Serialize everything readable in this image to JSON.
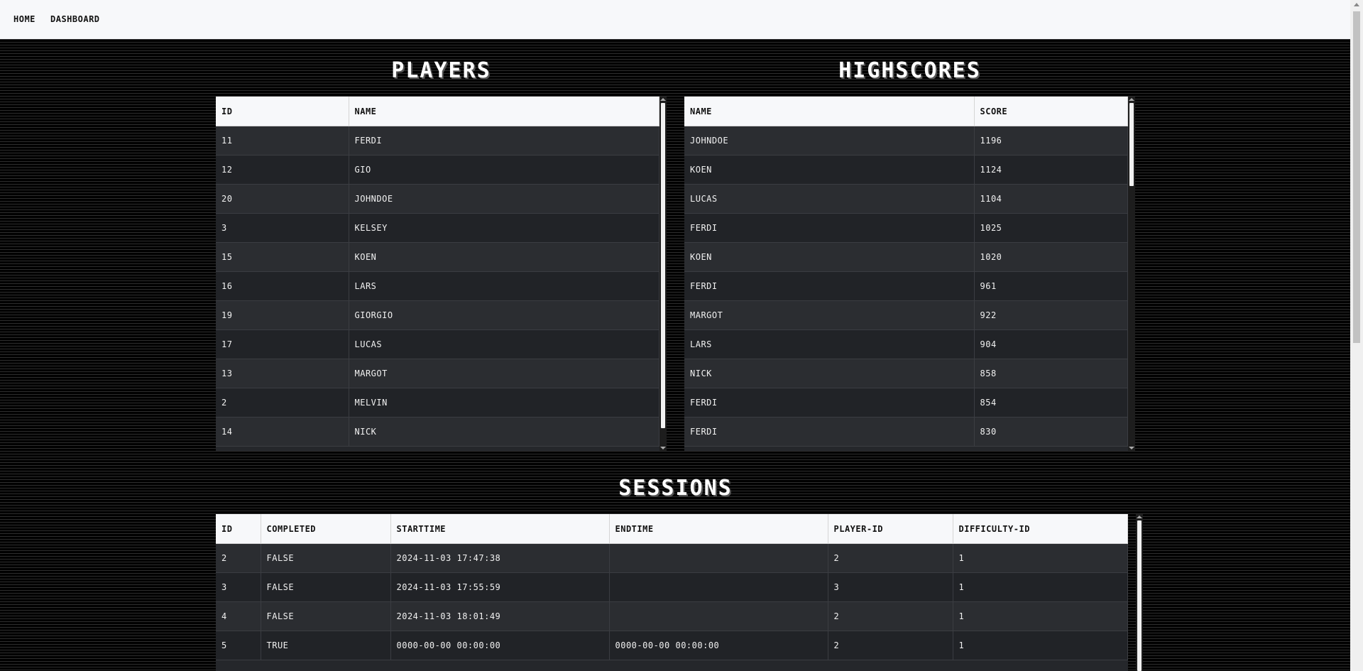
{
  "nav": {
    "home": "HOME",
    "dashboard": "DASHBOARD"
  },
  "players": {
    "title": "PLAYERS",
    "columns": [
      "ID",
      "NAME"
    ],
    "rows": [
      [
        "11",
        "FERDI"
      ],
      [
        "12",
        "GIO"
      ],
      [
        "20",
        "JOHNDOE"
      ],
      [
        "3",
        "KELSEY"
      ],
      [
        "15",
        "KOEN"
      ],
      [
        "16",
        "LARS"
      ],
      [
        "19",
        "GIORGIO"
      ],
      [
        "17",
        "LUCAS"
      ],
      [
        "13",
        "MARGOT"
      ],
      [
        "2",
        "MELVIN"
      ],
      [
        "14",
        "NICK"
      ]
    ]
  },
  "highscores": {
    "title": "HIGHSCORES",
    "columns": [
      "NAME",
      "SCORE"
    ],
    "rows": [
      [
        "JOHNDOE",
        "1196"
      ],
      [
        "KOEN",
        "1124"
      ],
      [
        "LUCAS",
        "1104"
      ],
      [
        "FERDI",
        "1025"
      ],
      [
        "KOEN",
        "1020"
      ],
      [
        "FERDI",
        "961"
      ],
      [
        "MARGOT",
        "922"
      ],
      [
        "LARS",
        "904"
      ],
      [
        "NICK",
        "858"
      ],
      [
        "FERDI",
        "854"
      ],
      [
        "FERDI",
        "830"
      ]
    ]
  },
  "sessions": {
    "title": "SESSIONS",
    "columns": [
      "ID",
      "COMPLETED",
      "STARTTIME",
      "ENDTIME",
      "PLAYER-ID",
      "DIFFICULTY-ID"
    ],
    "rows": [
      [
        "2",
        "FALSE",
        "2024-11-03 17:47:38",
        "",
        "2",
        "1"
      ],
      [
        "3",
        "FALSE",
        "2024-11-03 17:55:59",
        "",
        "3",
        "1"
      ],
      [
        "4",
        "FALSE",
        "2024-11-03 18:01:49",
        "",
        "2",
        "1"
      ],
      [
        "5",
        "TRUE",
        "0000-00-00 00:00:00",
        "0000-00-00 00:00:00",
        "2",
        "1"
      ]
    ]
  }
}
